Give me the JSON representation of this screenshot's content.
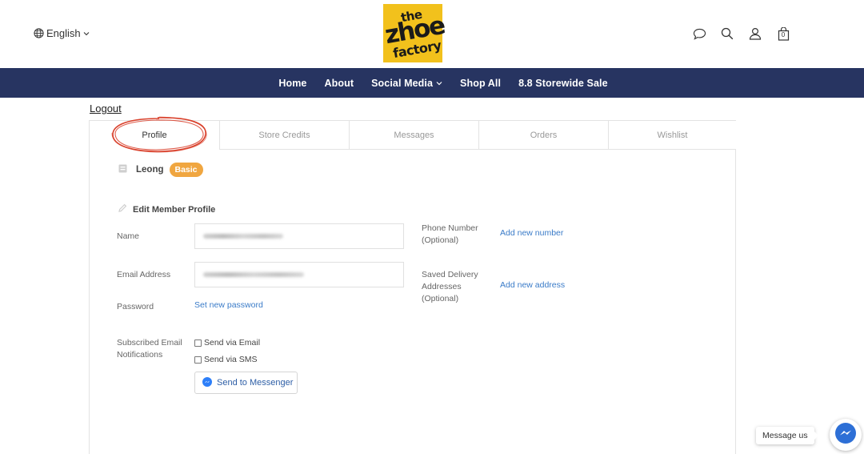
{
  "header": {
    "language": "English",
    "logo": {
      "line1": "the",
      "line2": "zhoe",
      "line3": "factory"
    },
    "icons": [
      "chat-icon",
      "search-icon",
      "user-icon",
      "cart-icon"
    ],
    "cart_count": "0"
  },
  "nav": {
    "items": [
      {
        "label": "Home"
      },
      {
        "label": "About"
      },
      {
        "label": "Social Media"
      },
      {
        "label": "Shop All"
      },
      {
        "label": "8.8 Storewide Sale"
      }
    ]
  },
  "account": {
    "logout": "Logout",
    "tabs": [
      "Profile",
      "Store Credits",
      "Messages",
      "Orders",
      "Wishlist"
    ],
    "member_name": "Leong",
    "member_tier": "Basic",
    "edit_title": "Edit Member Profile"
  },
  "form": {
    "name_label": "Name",
    "email_label": "Email Address",
    "password_label": "Password",
    "password_link": "Set new password",
    "notifications_label_1": "Subscribed Email",
    "notifications_label_2": "Notifications",
    "send_email": "Send via Email",
    "send_sms": "Send via SMS",
    "messenger_button": "Send to Messenger",
    "phone_label_1": "Phone Number",
    "phone_label_2": "(Optional)",
    "phone_link": "Add new number",
    "address_label_1": "Saved Delivery",
    "address_label_2": "Addresses",
    "address_label_3": "(Optional)",
    "address_link": "Add new address"
  },
  "chat_widget": {
    "label": "Message us"
  },
  "colors": {
    "nav_bg": "#273461",
    "logo_bg": "#f2c11c",
    "badge": "#f0a640",
    "link": "#3a7bc8",
    "annotation_circle": "#d9402b"
  }
}
